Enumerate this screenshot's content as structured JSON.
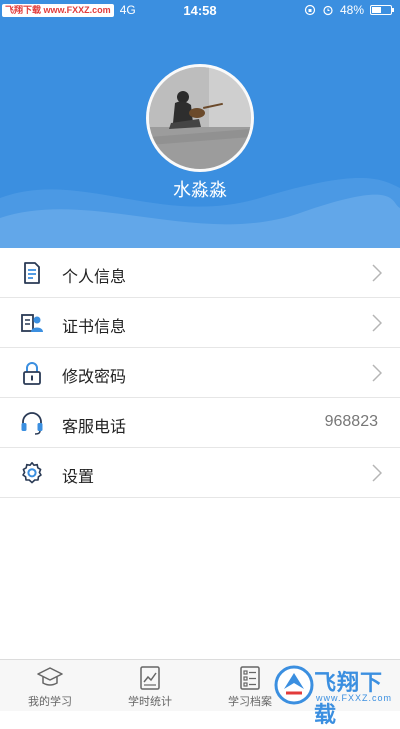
{
  "status_bar": {
    "watermark_tag": "飞翔下载 www.FXXZ.com",
    "network": "4G",
    "time": "14:58",
    "battery_percent_text": "48%",
    "battery_level": 0.48
  },
  "profile": {
    "username": "水淼淼"
  },
  "menu": {
    "items": [
      {
        "label": "个人信息",
        "icon": "document-icon"
      },
      {
        "label": "证书信息",
        "icon": "certificate-icon"
      },
      {
        "label": "修改密码",
        "icon": "lock-icon"
      },
      {
        "label": "客服电话",
        "icon": "headset-icon",
        "value": "968823"
      },
      {
        "label": "设置",
        "icon": "gear-icon"
      }
    ]
  },
  "tabbar": {
    "tabs": [
      {
        "label": "我的学习",
        "icon": "graduation-cap-icon"
      },
      {
        "label": "学时统计",
        "icon": "chart-icon"
      },
      {
        "label": "学习档案",
        "icon": "list-icon"
      }
    ]
  },
  "watermark": {
    "brand": "飞翔下载",
    "url": "www.FXXZ.com"
  },
  "colors": {
    "header_blue": "#3b8fe0",
    "text_dark": "#222222",
    "text_muted": "#777777",
    "divider": "#e6e6e6"
  }
}
